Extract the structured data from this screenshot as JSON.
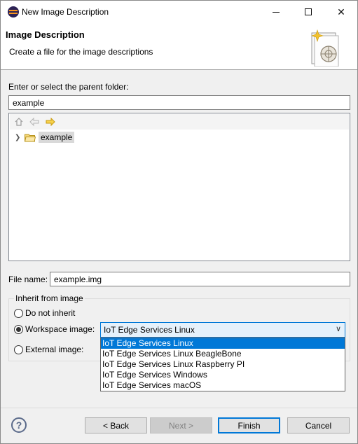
{
  "window": {
    "title": "New Image Description"
  },
  "banner": {
    "title": "Image Description",
    "description": "Create a file for the image descriptions"
  },
  "folder": {
    "label": "Enter or select the parent folder:",
    "value": "example",
    "tree": {
      "items": [
        {
          "label": "example",
          "expanded": false,
          "selected": true
        }
      ]
    },
    "toolbar_icons": [
      "home-icon",
      "back-arrow-icon",
      "forward-arrow-icon"
    ]
  },
  "file_name": {
    "label": "File name:",
    "value": "example.img"
  },
  "inherit": {
    "group_label": "Inherit from image",
    "options": [
      {
        "label": "Do not inherit",
        "checked": false
      },
      {
        "label": "Workspace image:",
        "checked": true
      },
      {
        "label": "External image:",
        "checked": false
      }
    ],
    "workspace_combo": {
      "value": "IoT Edge Services Linux",
      "options": [
        "IoT Edge Services Linux",
        "IoT Edge Services Linux BeagleBone",
        "IoT Edge Services Linux Raspberry PI",
        "IoT Edge Services Windows",
        "IoT Edge Services macOS"
      ]
    }
  },
  "buttons": {
    "back": "< Back",
    "next": "Next >",
    "finish": "Finish",
    "cancel": "Cancel",
    "help": "?"
  },
  "colors": {
    "accent": "#0078d7",
    "combo_bg": "#e5f1fb"
  }
}
